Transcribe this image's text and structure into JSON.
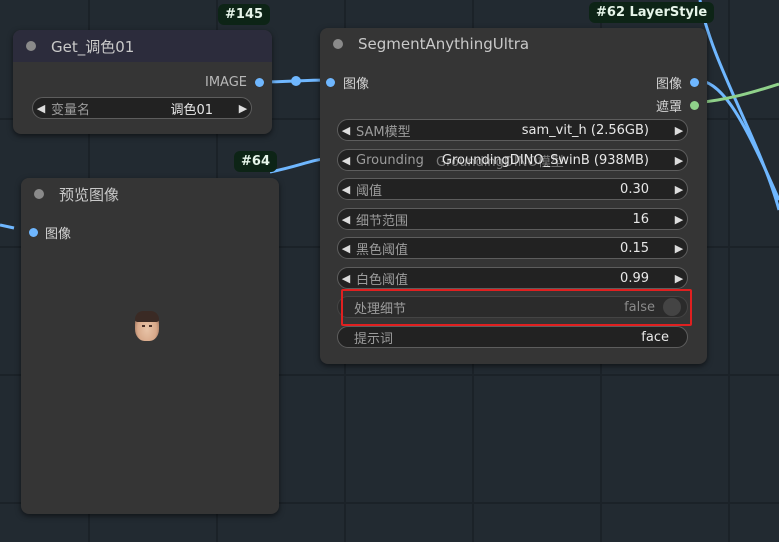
{
  "canvas": {
    "background": "#222a31"
  },
  "get_node": {
    "badge": "#145",
    "title": "Get_调色01",
    "output_label": "IMAGE",
    "widget": {
      "label": "变量名",
      "value": "调色01"
    }
  },
  "preview_node": {
    "badge": "#64",
    "title": "预览图像",
    "input_label": "图像"
  },
  "segment_node": {
    "badge": "#62 LayerStyle",
    "title": "SegmentAnythingUltra",
    "input_label": "图像",
    "outputs": [
      "图像",
      "遮罩"
    ],
    "widgets": {
      "sam_model": {
        "label": "SAM模型",
        "value": "sam_vit_h (2.56GB)"
      },
      "grounding": {
        "label": "Grounding",
        "overlap_label": "GroundingDINO模型",
        "value": "GroundingDINO_SwinB (938MB)"
      },
      "threshold": {
        "label": "阈值",
        "value": "0.30"
      },
      "detail_range": {
        "label": "细节范围",
        "value": "16"
      },
      "black_point": {
        "label": "黑色阈值",
        "value": "0.15"
      },
      "white_point": {
        "label": "白色阈值",
        "value": "0.99"
      },
      "process_detail": {
        "label": "处理细节",
        "value": "false"
      },
      "prompt": {
        "label": "提示词",
        "value": "face"
      }
    }
  },
  "colors": {
    "image_slot": "#6fb7ff",
    "mask_slot": "#8fd18a",
    "highlight": "#e02020",
    "badge_bg": "#0d2416"
  }
}
